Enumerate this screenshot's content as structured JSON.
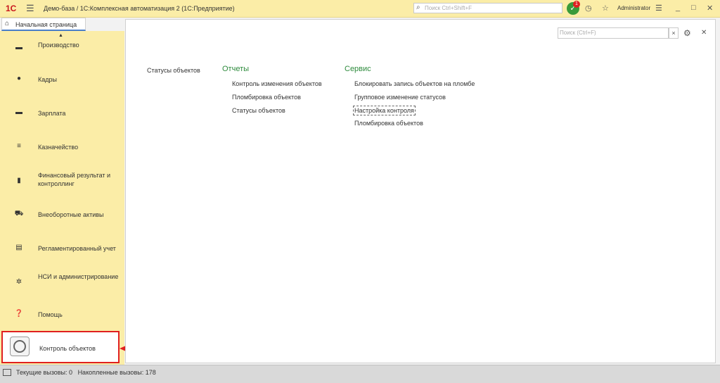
{
  "window": {
    "logo": "1С",
    "title": "Демо-база / 1С:Комплексная автоматизация 2  (1С:Предприятие)",
    "search_placeholder": "Поиск Ctrl+Shift+F",
    "notification_count": "1",
    "user": "Administrator",
    "icons": [
      "menu-icon",
      "search-icon",
      "notification-icon",
      "history-icon",
      "star-icon",
      "settings-icon",
      "minimize-icon",
      "maximize-icon",
      "close-icon"
    ]
  },
  "tabs": [
    {
      "label": "Начальная страница"
    }
  ],
  "sidebar": {
    "items": [
      {
        "label": "Производство",
        "icon": "factory-icon"
      },
      {
        "label": "Кадры",
        "icon": "person-icon"
      },
      {
        "label": "Зарплата",
        "icon": "wallet-icon"
      },
      {
        "label": "Казначейство",
        "icon": "treasury-icon"
      },
      {
        "label": "Финансовый результат и контроллинг",
        "icon": "chart-icon"
      },
      {
        "label": "Внеоборотные активы",
        "icon": "car-icon"
      },
      {
        "label": "Регламентированный учет",
        "icon": "document-icon"
      },
      {
        "label": "НСИ и администрирование",
        "icon": "gear-icon"
      },
      {
        "label": "Помощь",
        "icon": "help-icon"
      }
    ],
    "highlighted": {
      "label": "Контроль объектов",
      "icon": "object-control-icon"
    }
  },
  "content": {
    "search_placeholder": "Поиск (Ctrl+F)",
    "nav_link": "Статусы объектов",
    "groups": [
      {
        "header": "Отчеты",
        "items": [
          "Контроль изменения объектов",
          "Пломбировка объектов",
          "Статусы объектов"
        ]
      },
      {
        "header": "Сервис",
        "items": [
          "Блокировать запись объектов на пломбе",
          "Групповое изменение статусов",
          "Настройка контроля",
          "Пломбировка объектов"
        ]
      }
    ]
  },
  "statusbar": {
    "current_calls_label": "Текущие вызовы:",
    "current_calls": "0",
    "accumulated_calls_label": "Накопленные вызовы:",
    "accumulated_calls": "178"
  },
  "colors": {
    "accent_green": "#2e8b3d",
    "highlight_red": "#e02020",
    "sidebar_bg": "#fbeda7"
  }
}
